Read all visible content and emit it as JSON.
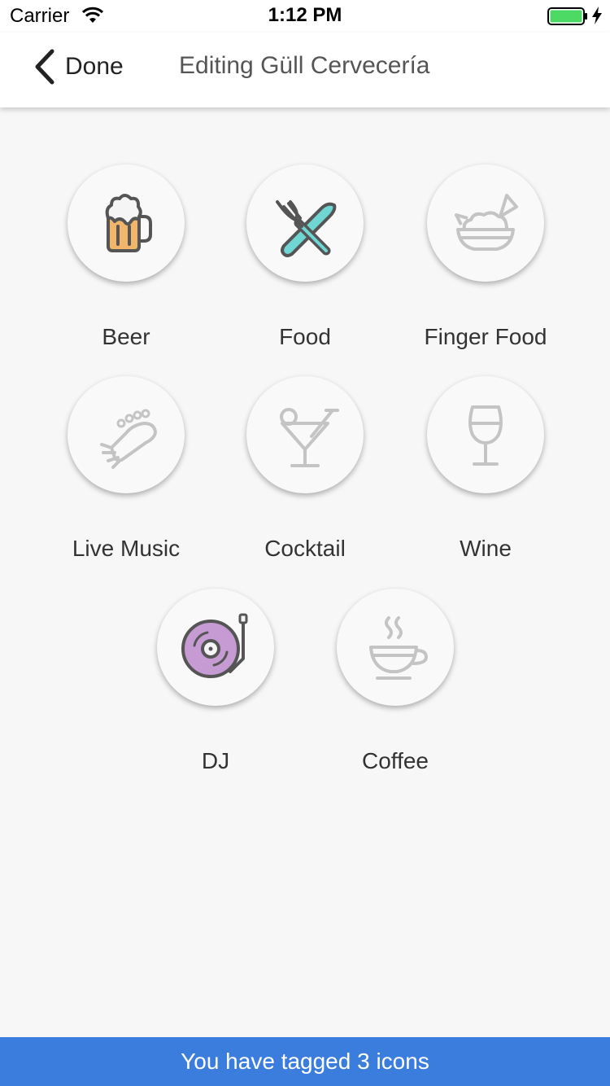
{
  "status_bar": {
    "carrier": "Carrier",
    "time": "1:12 PM",
    "icons": [
      "wifi-icon",
      "battery-icon",
      "charging-icon"
    ]
  },
  "nav": {
    "back_label": "Done",
    "title": "Editing Güll Cervecería"
  },
  "tiles": [
    {
      "label": "Beer",
      "icon": "beer-mug-icon",
      "tagged": true,
      "accent": "#f2b66b"
    },
    {
      "label": "Food",
      "icon": "fork-knife-icon",
      "tagged": true,
      "accent": "#6fd6d3"
    },
    {
      "label": "Finger Food",
      "icon": "finger-food-bowl-icon",
      "tagged": false
    },
    {
      "label": "Live Music",
      "icon": "guitar-head-icon",
      "tagged": false
    },
    {
      "label": "Cocktail",
      "icon": "cocktail-glass-icon",
      "tagged": false
    },
    {
      "label": "Wine",
      "icon": "wine-glass-icon",
      "tagged": false
    },
    {
      "label": "DJ",
      "icon": "turntable-icon",
      "tagged": true,
      "accent": "#c69ad3"
    },
    {
      "label": "Coffee",
      "icon": "coffee-cup-icon",
      "tagged": false
    }
  ],
  "banner": {
    "text": "You have tagged 3 icons"
  },
  "colors": {
    "banner": "#3b7ddd",
    "inactive_icon": "#c4c4c4",
    "outline": "#555555",
    "battery": "#4cd964"
  }
}
